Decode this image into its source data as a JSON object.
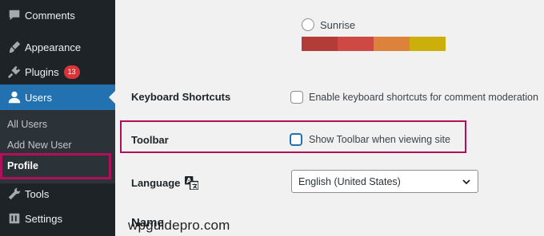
{
  "sidebar": {
    "items": {
      "comments": {
        "label": "Comments",
        "icon": "comment-icon"
      },
      "appearance": {
        "label": "Appearance",
        "icon": "paintbrush-icon"
      },
      "plugins": {
        "label": "Plugins",
        "icon": "plugin-icon",
        "badge": "13"
      },
      "users": {
        "label": "Users",
        "icon": "user-icon",
        "active": true
      },
      "tools": {
        "label": "Tools",
        "icon": "wrench-icon"
      },
      "settings": {
        "label": "Settings",
        "icon": "settings-icon"
      }
    },
    "submenu": {
      "all_users": "All Users",
      "add_new_user": "Add New User",
      "profile": "Profile"
    }
  },
  "color_scheme": {
    "option_label": "Sunrise",
    "swatches": [
      "#b43c38",
      "#cf4944",
      "#dd823b",
      "#ccaf0b"
    ]
  },
  "settings": {
    "keyboard_shortcuts": {
      "label": "Keyboard Shortcuts",
      "checkbox_text": "Enable keyboard shortcuts for comment moderation",
      "checked": false
    },
    "toolbar": {
      "label": "Toolbar",
      "checkbox_text": "Show Toolbar when viewing site",
      "checked": false
    },
    "language": {
      "label": "Language",
      "icon": "translate-icon",
      "selected": "English (United States)"
    },
    "name_heading": "Name"
  },
  "watermark": "wpguidepro.com",
  "colors": {
    "sidebar_bg": "#1d2327",
    "submenu_bg": "#2c3338",
    "accent": "#2271b1",
    "badge": "#d63638",
    "highlight": "#b0105a"
  }
}
